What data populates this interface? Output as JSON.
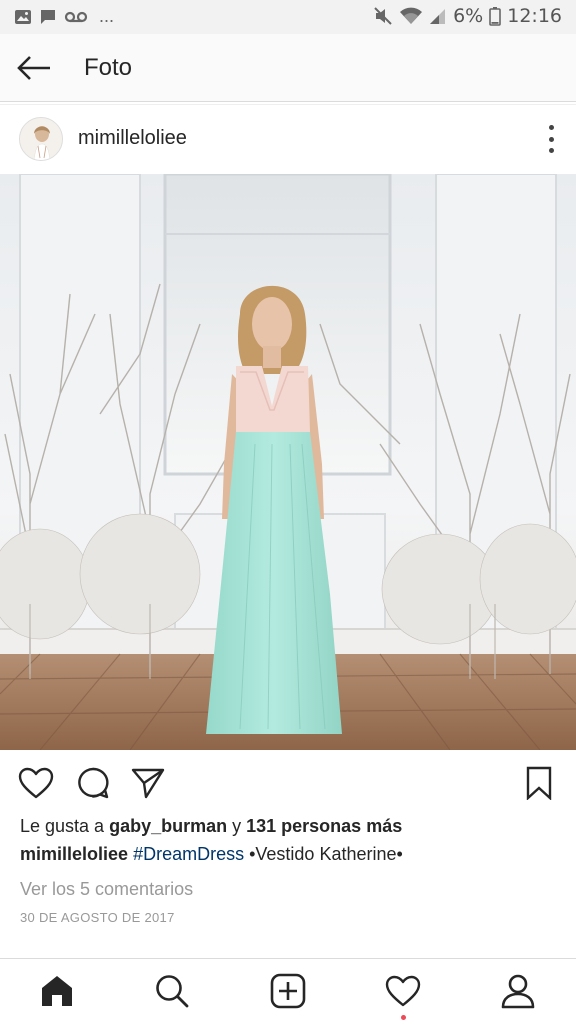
{
  "status_bar": {
    "overflow_label": "...",
    "battery": "6%",
    "time": "12:16",
    "icons": [
      "image-icon",
      "chat-icon",
      "voicemail-icon",
      "mute-icon",
      "wifi-icon",
      "signal-icon",
      "battery-icon"
    ]
  },
  "app_bar": {
    "title": "Foto"
  },
  "post": {
    "username": "mimilleloliee",
    "likes": {
      "prefix": "Le gusta a ",
      "liker": "gaby_burman",
      "conjunction": " y ",
      "others": "131 personas más"
    },
    "caption": {
      "user": "mimilleloliee",
      "hashtag": "#DreamDress",
      "text": " •Vestido Katherine•"
    },
    "comments_link": "Ver los 5 comentarios",
    "date": "30 DE AGOSTO DE 2017"
  },
  "bottom_nav": {
    "items": [
      "home-icon",
      "search-icon",
      "new-post-icon",
      "activity-icon",
      "profile-icon"
    ],
    "active": "home-icon",
    "notification_color": "#ed4956"
  },
  "colors": {
    "text": "#262626",
    "muted": "#999999",
    "hashtag": "#003569",
    "dress": "#a9e4d8",
    "bodice": "#f3d8d2"
  }
}
